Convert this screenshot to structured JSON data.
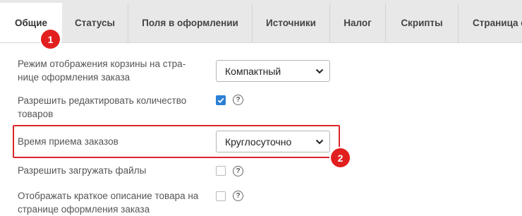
{
  "tabs": [
    {
      "label": "Общие",
      "active": true
    },
    {
      "label": "Статусы"
    },
    {
      "label": "Поля в оформлении"
    },
    {
      "label": "Источники"
    },
    {
      "label": "Налог"
    },
    {
      "label": "Скрипты"
    },
    {
      "label": "Страница оформления"
    }
  ],
  "markers": {
    "first": "1",
    "second": "2"
  },
  "settings": {
    "cart_display": {
      "label_line1": "Режим отображения корзины на стра-",
      "label_line2": "нице оформления заказа",
      "value": "Компактный"
    },
    "edit_quantity": {
      "label_line1": "Разрешить редактировать количество",
      "label_line2": "товаров",
      "checked": true
    },
    "order_time": {
      "label": "Время приема заказов",
      "value": "Круглосуточно"
    },
    "file_upload": {
      "label": "Разрешить загружать файлы",
      "checked": false
    },
    "short_description": {
      "label_line1": "Отображать краткое описание товара на",
      "label_line2": "странице оформления заказа",
      "checked": false
    }
  },
  "help_glyph": "?",
  "colors": {
    "accent": "#2d7fd4",
    "marker": "#e21f1f",
    "highlight": "#d9262b",
    "tab_bg": "#e8e8e8"
  },
  "icons": [
    "chevron-down-icon",
    "help-icon",
    "checkmark-icon"
  ]
}
